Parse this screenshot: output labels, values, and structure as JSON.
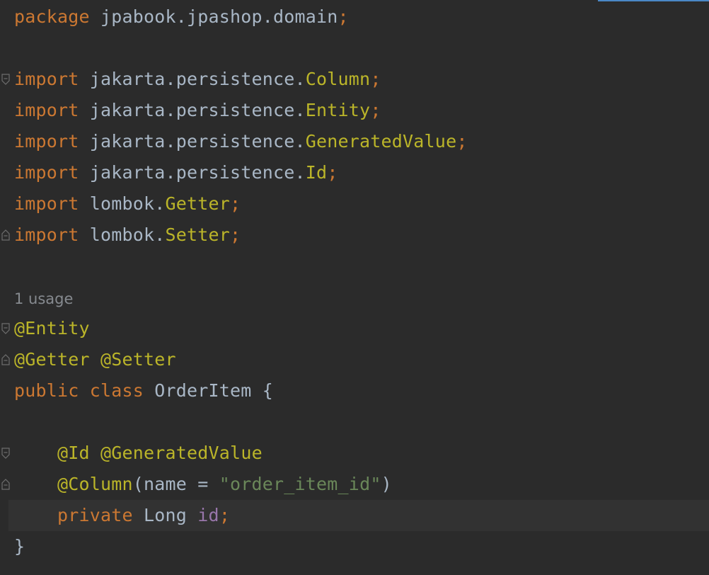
{
  "editor": {
    "code_lines": [
      {
        "id": "l1",
        "tokens": [
          {
            "t": "package",
            "c": "kw"
          },
          {
            "t": " jpabook.jpashop.domain",
            "c": "plain"
          },
          {
            "t": ";",
            "c": "kw"
          }
        ]
      },
      {
        "id": "l2",
        "tokens": []
      },
      {
        "id": "l3",
        "tokens": [
          {
            "t": "import",
            "c": "kw"
          },
          {
            "t": " jakarta.persistence.",
            "c": "plain"
          },
          {
            "t": "Column",
            "c": "cls"
          },
          {
            "t": ";",
            "c": "kw"
          }
        ]
      },
      {
        "id": "l4",
        "tokens": [
          {
            "t": "import",
            "c": "kw"
          },
          {
            "t": " jakarta.persistence.",
            "c": "plain"
          },
          {
            "t": "Entity",
            "c": "cls"
          },
          {
            "t": ";",
            "c": "kw"
          }
        ]
      },
      {
        "id": "l5",
        "tokens": [
          {
            "t": "import",
            "c": "kw"
          },
          {
            "t": " jakarta.persistence.",
            "c": "plain"
          },
          {
            "t": "GeneratedValue",
            "c": "cls"
          },
          {
            "t": ";",
            "c": "kw"
          }
        ]
      },
      {
        "id": "l6",
        "tokens": [
          {
            "t": "import",
            "c": "kw"
          },
          {
            "t": " jakarta.persistence.",
            "c": "plain"
          },
          {
            "t": "Id",
            "c": "cls"
          },
          {
            "t": ";",
            "c": "kw"
          }
        ]
      },
      {
        "id": "l7",
        "tokens": [
          {
            "t": "import",
            "c": "kw"
          },
          {
            "t": " lombok.",
            "c": "plain"
          },
          {
            "t": "Getter",
            "c": "cls"
          },
          {
            "t": ";",
            "c": "kw"
          }
        ]
      },
      {
        "id": "l8",
        "tokens": [
          {
            "t": "import",
            "c": "kw"
          },
          {
            "t": " lombok.",
            "c": "plain"
          },
          {
            "t": "Setter",
            "c": "cls"
          },
          {
            "t": ";",
            "c": "kw"
          }
        ]
      },
      {
        "id": "l9",
        "tokens": []
      },
      {
        "id": "l10",
        "tokens": []
      },
      {
        "id": "l11",
        "tokens": [
          {
            "t": "@Entity",
            "c": "ann"
          }
        ]
      },
      {
        "id": "l12",
        "tokens": [
          {
            "t": "@Getter",
            "c": "ann"
          },
          {
            "t": " ",
            "c": "plain"
          },
          {
            "t": "@Setter",
            "c": "ann"
          }
        ]
      },
      {
        "id": "l13",
        "tokens": [
          {
            "t": "public",
            "c": "kw"
          },
          {
            "t": " ",
            "c": "plain"
          },
          {
            "t": "class",
            "c": "kw"
          },
          {
            "t": " OrderItem {",
            "c": "plain"
          }
        ]
      },
      {
        "id": "l14",
        "tokens": []
      },
      {
        "id": "l15",
        "tokens": [
          {
            "t": "    ",
            "c": "plain"
          },
          {
            "t": "@Id",
            "c": "ann"
          },
          {
            "t": " ",
            "c": "plain"
          },
          {
            "t": "@GeneratedValue",
            "c": "ann"
          }
        ]
      },
      {
        "id": "l16",
        "tokens": [
          {
            "t": "    ",
            "c": "plain"
          },
          {
            "t": "@Column",
            "c": "ann"
          },
          {
            "t": "(name = ",
            "c": "plain"
          },
          {
            "t": "\"order_item_id\"",
            "c": "str"
          },
          {
            "t": ")",
            "c": "plain"
          }
        ]
      },
      {
        "id": "l17",
        "tokens": [
          {
            "t": "    ",
            "c": "plain"
          },
          {
            "t": "private",
            "c": "kw"
          },
          {
            "t": " Long ",
            "c": "plain"
          },
          {
            "t": "id",
            "c": "field"
          },
          {
            "t": ";",
            "c": "kw"
          }
        ]
      },
      {
        "id": "l18",
        "tokens": [
          {
            "t": "}",
            "c": "plain"
          }
        ]
      }
    ],
    "usage_hint": "1 usage",
    "icons": [
      "fold-start-icon",
      "fold-end-icon"
    ]
  }
}
